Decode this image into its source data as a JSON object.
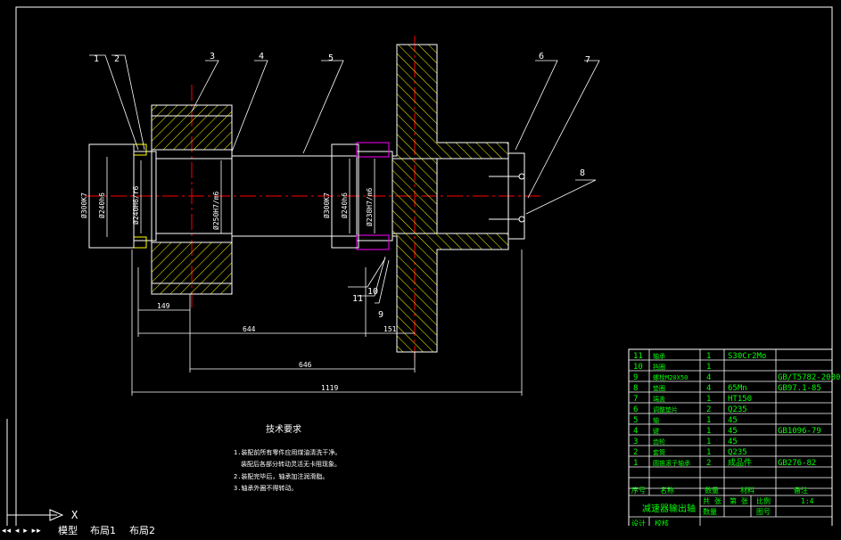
{
  "part_balloons": [
    "1",
    "2",
    "3",
    "4",
    "5",
    "6",
    "7",
    "8",
    "9",
    "10",
    "11"
  ],
  "dimensions": {
    "d_shaft_left": "Ø240H6/r6",
    "d_bearing_left": "Ø240h6",
    "d_outer_left": "Ø300K7",
    "d_gear_bore": "Ø250H7/m6",
    "d_shaft_right": "Ø240h6",
    "d_outer_right": "Ø300K7",
    "d_hub": "Ø238H7/m6",
    "len_149": "149",
    "len_644": "644",
    "len_151": "151",
    "len_646": "646",
    "len_1119": "1119"
  },
  "notes": {
    "title": "技术要求",
    "lines": [
      "1.装配前所有零件应用煤油清洗干净。",
      "装配后各部分转动灵活无卡阻现象。",
      "2.装配完毕后，轴承加注润滑脂。",
      "3.轴承外圈不得转动。"
    ]
  },
  "bom": {
    "rows": [
      {
        "no": "11",
        "name": "轴承",
        "qty": "1",
        "material": "S30Cr2Mo",
        "note": ""
      },
      {
        "no": "10",
        "name": "挡圈",
        "qty": "1",
        "material": "",
        "note": ""
      },
      {
        "no": "9",
        "name": "螺栓M20X50",
        "qty": "4",
        "material": "",
        "note": "GB/T5782-2000"
      },
      {
        "no": "8",
        "name": "垫圈",
        "qty": "4",
        "material": "65Mn",
        "note": "GB97.1-85"
      },
      {
        "no": "7",
        "name": "端盖",
        "qty": "1",
        "material": "HT150",
        "note": ""
      },
      {
        "no": "6",
        "name": "调整垫片",
        "qty": "2",
        "material": "Q235",
        "note": ""
      },
      {
        "no": "5",
        "name": "轴",
        "qty": "1",
        "material": "45",
        "note": ""
      },
      {
        "no": "4",
        "name": "键",
        "qty": "1",
        "material": "45",
        "note": "GB1096-79"
      },
      {
        "no": "3",
        "name": "齿轮",
        "qty": "1",
        "material": "45",
        "note": ""
      },
      {
        "no": "2",
        "name": "套筒",
        "qty": "1",
        "material": "Q235",
        "note": ""
      },
      {
        "no": "1",
        "name": "圆锥滚子轴承",
        "qty": "2",
        "material": "成品件",
        "note": "GB276-82"
      }
    ],
    "header": {
      "no": "序号",
      "name": "名称",
      "qty": "数量",
      "material": "材料",
      "note": "备注"
    },
    "title": "减速器输出轴",
    "scale_label": "比例",
    "scale": "1:4",
    "row_labels": [
      "共 张",
      "第 张",
      "数量",
      "图号",
      "设计",
      "校核"
    ]
  },
  "ucs": {
    "x_label": "X"
  },
  "tabs": [
    "模型",
    "布局1",
    "布局2"
  ],
  "colors": {
    "background": "#000000",
    "outline": "#ffffff",
    "centerline": "#ff0000",
    "dimension": "#00ff00",
    "hatch": "#ffff00",
    "bolt": "#ff00ff",
    "table_text": "#00ff00"
  }
}
